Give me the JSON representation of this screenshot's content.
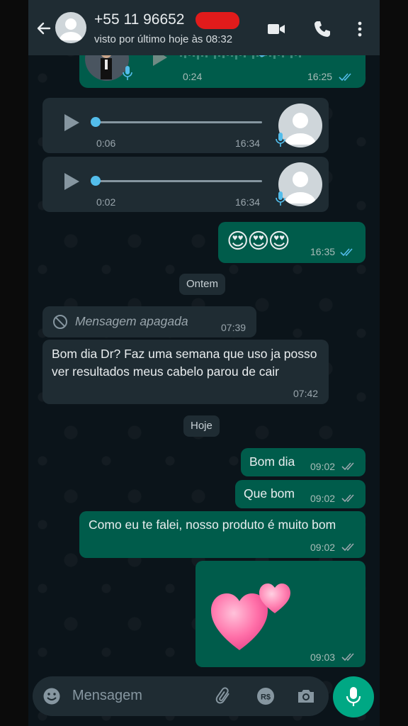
{
  "header": {
    "contact_name": "+55 11 96652",
    "last_seen": "visto por último hoje às 08:32"
  },
  "messages": {
    "partial_audio": {
      "duration": "0:24",
      "time": "16:25"
    },
    "audio1": {
      "duration": "0:06",
      "time": "16:34"
    },
    "audio2": {
      "duration": "0:02",
      "time": "16:34"
    },
    "emoji_msg": {
      "text": "😍😍😍",
      "time": "16:35"
    },
    "date_yesterday": "Ontem",
    "deleted": {
      "text": "Mensagem apagada",
      "time": "07:39"
    },
    "incoming_text": {
      "text": "Bom dia Dr? Faz uma semana que uso ja posso ver resultados meus cabelo parou de cair",
      "time": "07:42"
    },
    "date_today": "Hoje",
    "out1": {
      "text": "Bom dia",
      "time": "09:02"
    },
    "out2": {
      "text": "Que bom",
      "time": "09:02"
    },
    "out3": {
      "text": "Como eu te falei, nosso produto é muito bom",
      "time": "09:02"
    },
    "sticker": {
      "time": "09:03"
    }
  },
  "input": {
    "placeholder": "Mensagem"
  },
  "colors": {
    "outgoing": "#005c4b",
    "incoming": "#1f2c33",
    "accent": "#00a884",
    "read_ticks": "#53bdeb"
  }
}
